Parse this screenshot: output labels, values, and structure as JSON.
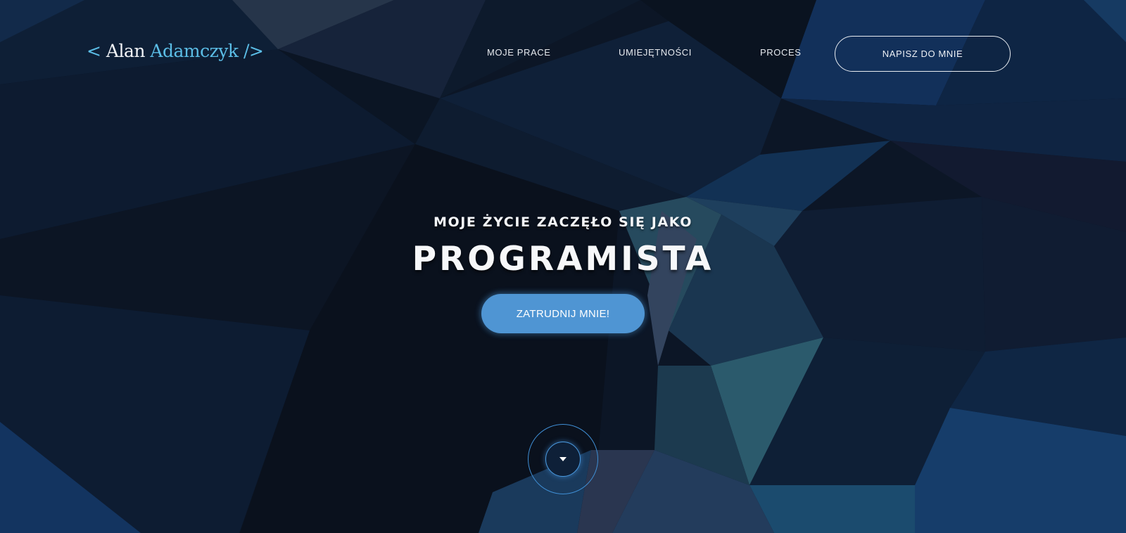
{
  "header": {
    "logo": {
      "open_bracket": "< ",
      "first_name": "Alan",
      "last_name": "Adamczyk",
      "close_bracket": "/>"
    },
    "nav": [
      {
        "label": "MOJE PRACE"
      },
      {
        "label": "UMIEJĘTNOŚCI"
      },
      {
        "label": "PROCES"
      }
    ],
    "contact_button": "NAPISZ DO MNIE"
  },
  "hero": {
    "subtitle": "MOJE ŻYCIE ZACZĘŁO SIĘ JAKO",
    "title": "PROGRAMISTA",
    "cta_button": "ZATRUDNIJ MNIE!"
  },
  "scroll_down": {
    "icon": "caret-down-icon"
  },
  "colors": {
    "accent": "#5bbde6",
    "button": "#4f95d3",
    "background": "#0b1524"
  }
}
